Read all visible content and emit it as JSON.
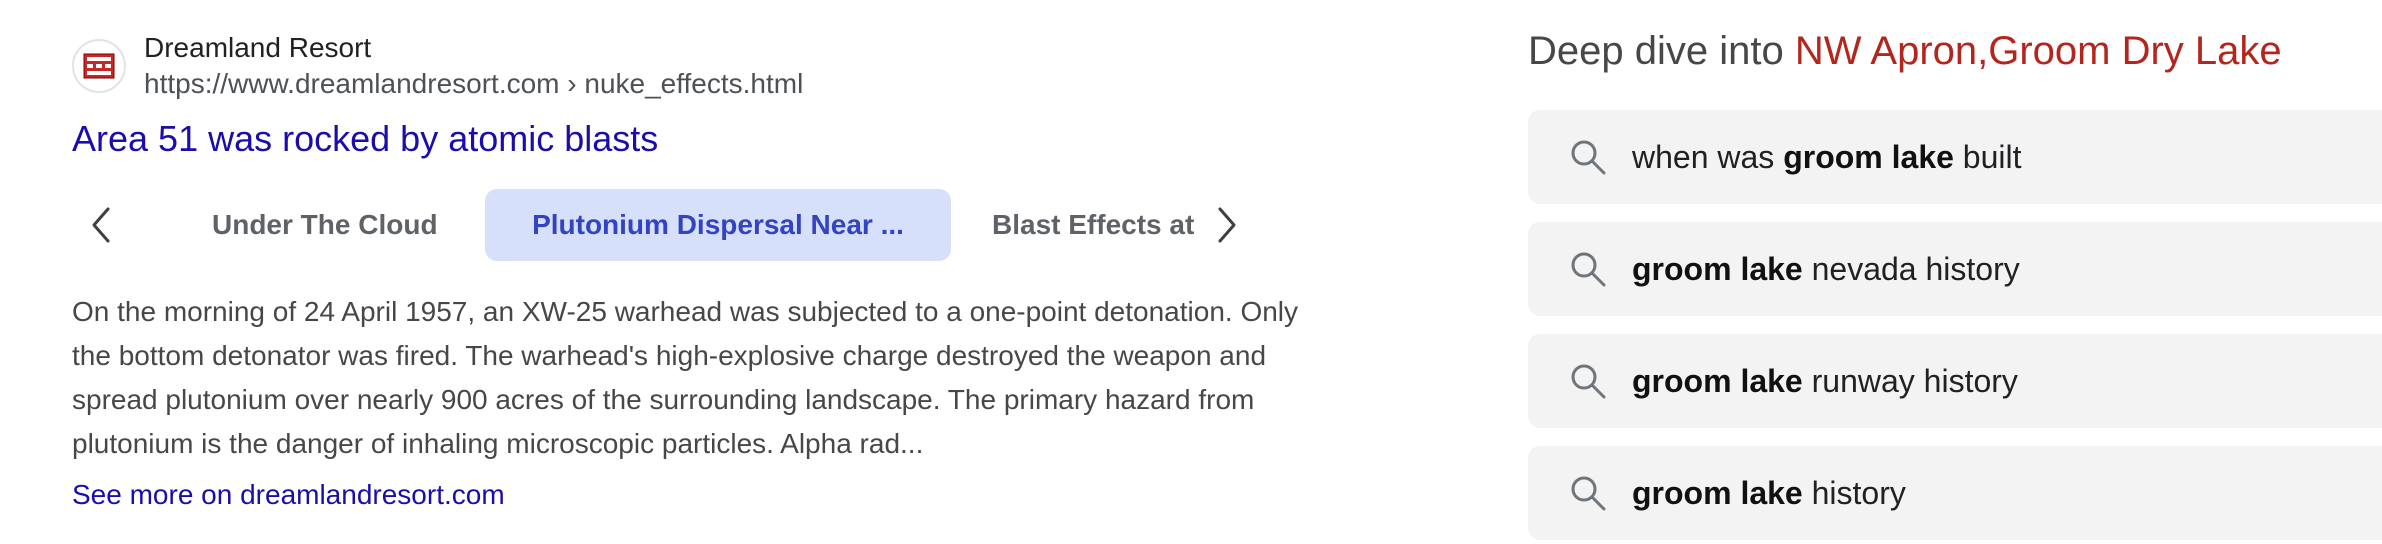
{
  "result": {
    "site_name": "Dreamland Resort",
    "site_url": "https://www.dreamlandresort.com › nuke_effects.html",
    "favicon_icon": "dreamland-resort-favicon",
    "title": "Area 51 was rocked by atomic blasts",
    "tabs": [
      {
        "label": "Under The Cloud",
        "selected": false
      },
      {
        "label": "Plutonium Dispersal Near ...",
        "selected": true
      },
      {
        "label": "Blast Effects at W",
        "selected": false
      }
    ],
    "prev_icon": "chevron-left-icon",
    "next_icon": "chevron-right-icon",
    "snippet": "On the morning of 24 April 1957, an XW-25 warhead was subjected to a one-point detonation. Only the bottom detonator was fired. The warhead's high-explosive charge destroyed the weapon and spread plutonium over nearly 900 acres of the surrounding landscape. The primary hazard from plutonium is the danger of inhaling microscopic particles. Alpha rad...",
    "see_more": "See more on dreamlandresort.com"
  },
  "deep_dive": {
    "prefix": "Deep dive into ",
    "topic": "NW Apron,Groom Dry Lake"
  },
  "suggestions": [
    {
      "pre": "when was ",
      "bold": "groom lake",
      "post": " built"
    },
    {
      "pre": "",
      "bold": "groom lake",
      "post": " nevada history"
    },
    {
      "pre": "",
      "bold": "groom lake",
      "post": " runway history"
    },
    {
      "pre": "",
      "bold": "groom lake",
      "post": " history"
    }
  ],
  "colors": {
    "link": "#1a0dab",
    "topic": "#b3261e",
    "selected_tab_bg": "#d6e0fb",
    "selected_tab_text": "#3443c3",
    "suggestion_bg": "#f3f3f3"
  }
}
